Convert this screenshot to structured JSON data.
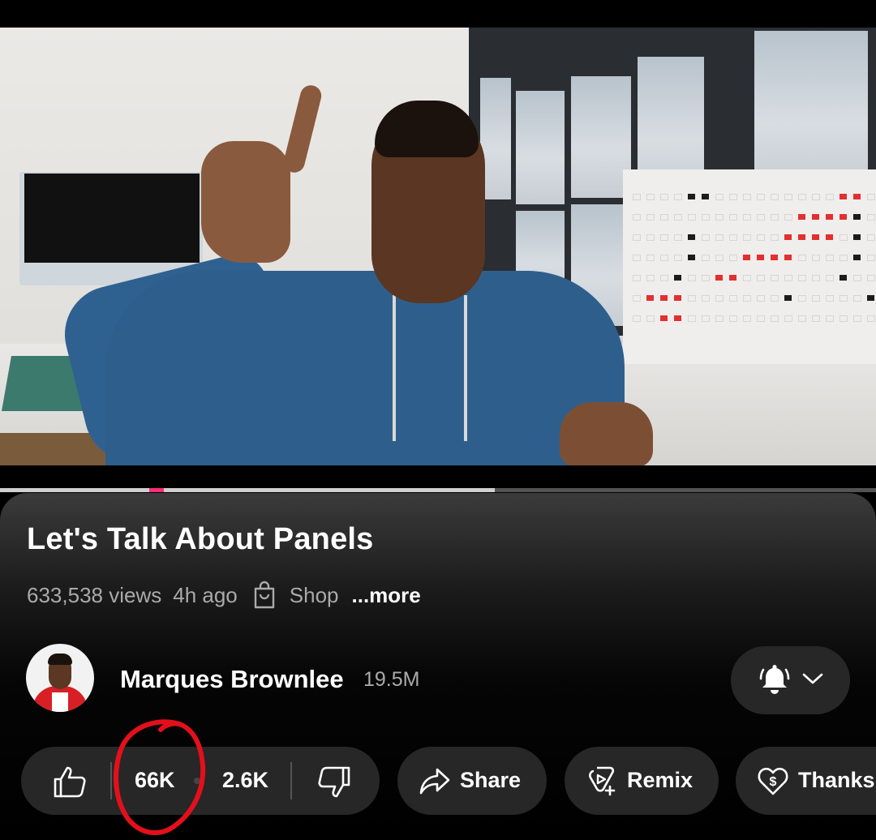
{
  "video": {
    "progress_played_fraction": 0.565,
    "accent": "#ff2d7a"
  },
  "title": "Let's Talk About Panels",
  "meta": {
    "views": "633,538 views",
    "age": "4h ago",
    "shop_label": "Shop",
    "more_label": "...more"
  },
  "channel": {
    "name": "Marques Brownlee",
    "subscribers": "19.5M"
  },
  "actions": {
    "like_count": "66K",
    "dislike_count": "2.6K",
    "share_label": "Share",
    "remix_label": "Remix",
    "thanks_label": "Thanks"
  },
  "icons": [
    "thumbs-up-icon",
    "thumbs-down-icon",
    "share-icon",
    "remix-icon",
    "thanks-icon",
    "bell-icon",
    "chevron-down-icon",
    "shopping-bag-icon"
  ],
  "colors": {
    "pill_background": "#272727",
    "annotation": "#e3101b"
  }
}
